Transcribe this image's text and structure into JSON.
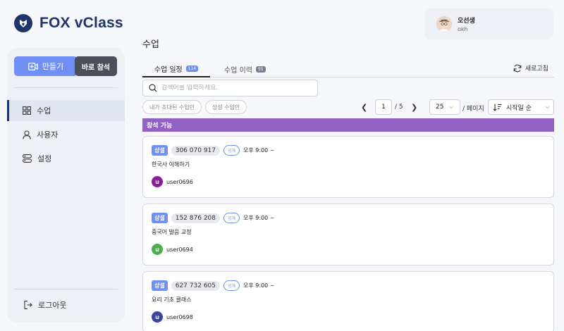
{
  "app": {
    "title": "FOX vClass"
  },
  "sidebar": {
    "create_label": "만들기",
    "join_label": "바로 참석",
    "items": [
      {
        "label": "수업",
        "icon": "grid-icon",
        "active": true
      },
      {
        "label": "사용자",
        "icon": "user-icon",
        "active": false
      },
      {
        "label": "설정",
        "icon": "settings-icon",
        "active": false
      }
    ],
    "logout_label": "로그아웃"
  },
  "user": {
    "name": "오선생",
    "id": "okh"
  },
  "page": {
    "title": "수업"
  },
  "tabs": [
    {
      "label": "수업 일정",
      "count": "114",
      "active": true
    },
    {
      "label": "수업 이력",
      "count": "55",
      "active": false
    }
  ],
  "refresh_label": "새로고침",
  "search": {
    "placeholder": "검색어를 입력하세요."
  },
  "filters": [
    "내가 초대된 수업만",
    "상설 수업만"
  ],
  "pagination": {
    "current": "1",
    "total": "/ 5"
  },
  "per_page": {
    "value": "25",
    "label": "/ 페이지"
  },
  "sort": {
    "value": "시작일 순"
  },
  "section": {
    "label": "참석 가능"
  },
  "classes": [
    {
      "type": "상설",
      "code": "306 070 917",
      "visibility": "공개",
      "time": "오후 9:00 ~",
      "title": "한국사 이해하기",
      "host": "user0696",
      "host_initial": "u",
      "host_color": "#8e1c9e"
    },
    {
      "type": "상설",
      "code": "152 876 208",
      "visibility": "공개",
      "time": "오후 9:00 ~",
      "title": "중국어 발음 교정",
      "host": "user0694",
      "host_initial": "u",
      "host_color": "#4cae4f"
    },
    {
      "type": "상설",
      "code": "627 732 605",
      "visibility": "공개",
      "time": "오후 9:00 ~",
      "title": "요리 기초 클래스",
      "host": "user0698",
      "host_initial": "u",
      "host_color": "#3a45a3"
    }
  ],
  "colors": {
    "accent": "#6f8ff5",
    "brand": "#1f3468",
    "section": "#9161c4",
    "join_button": "#4a4f5a"
  }
}
